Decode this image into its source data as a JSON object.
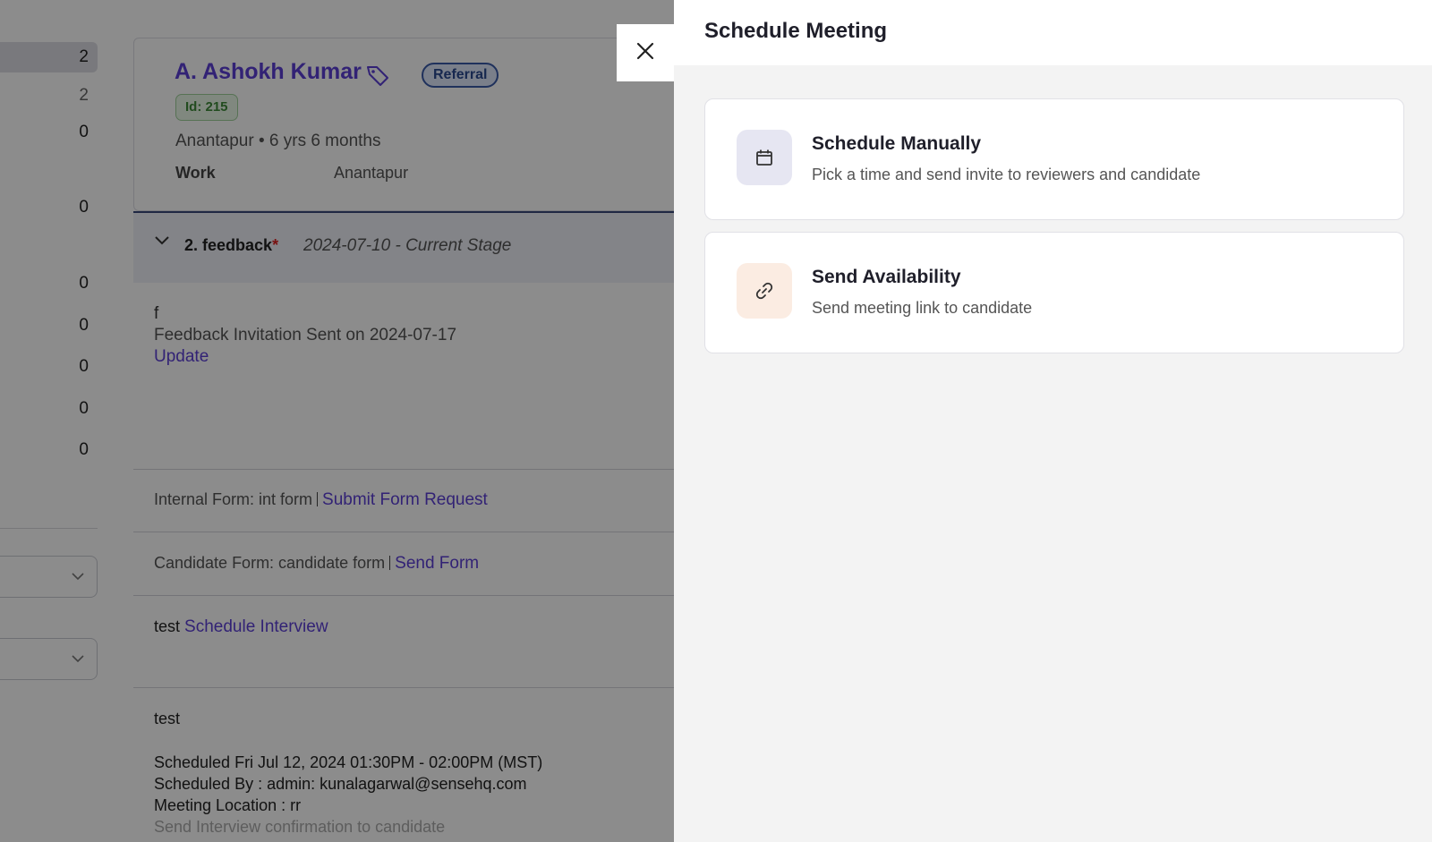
{
  "left_panel": {
    "counts": [
      "2",
      "2",
      "0",
      "0",
      "0",
      "0",
      "0",
      "0",
      "0"
    ]
  },
  "candidate": {
    "name": "A. Ashokh Kumar",
    "source_badge": "Referral",
    "id_label": "Id: 215",
    "location_line": "Anantapur • 6 yrs 6 months",
    "work_label": "Work",
    "work_value": "Anantapur"
  },
  "stage": {
    "name": "2. feedback",
    "required_mark": "*",
    "date_text": "2024-07-10 - Current Stage"
  },
  "feedback": {
    "line1": "f",
    "line2": "Feedback Invitation Sent on 2024-07-17",
    "update_link": "Update"
  },
  "forms": {
    "internal_label": "Internal Form: int form",
    "internal_link": "Submit Form Request",
    "candidate_label": "Candidate Form: candidate form",
    "candidate_link": "Send Form",
    "test_label": "test",
    "schedule_link": "Schedule Interview"
  },
  "scheduled": {
    "title": "test",
    "when": "Scheduled Fri Jul 12, 2024 01:30PM - 02:00PM (MST)",
    "by": "Scheduled By :  admin: kunalagarwal@sensehq.com",
    "location": "Meeting Location : rr",
    "trailing": "Send Interview confirmation to candidate"
  },
  "drawer": {
    "title": "Schedule Meeting",
    "options": [
      {
        "title": "Schedule Manually",
        "subtitle": "Pick a time and send invite to reviewers and candidate",
        "icon": "calendar-icon",
        "icon_bg": "#e6e6f2"
      },
      {
        "title": "Send Availability",
        "subtitle": "Send meeting link to candidate",
        "icon": "link-icon",
        "icon_bg": "#fbece2"
      }
    ]
  },
  "colors": {
    "accent": "#5b3fd6",
    "overlay": "rgba(0,0,0,0.45)"
  }
}
